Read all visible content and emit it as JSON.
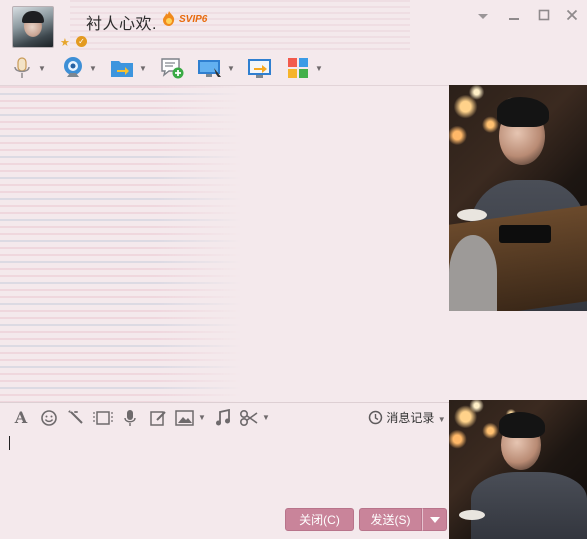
{
  "title_bar": {
    "nickname": "衬人心欢.",
    "vip_badge": "SVIP6",
    "icons": [
      "avatar",
      "flame-badge-icon",
      "star-icon",
      "verified-icon"
    ],
    "window_controls": [
      "dropdown-icon",
      "minimize-icon",
      "maximize-icon",
      "close-icon"
    ]
  },
  "toolbar": {
    "items": [
      "voice-call-icon",
      "video-call-icon",
      "send-file-icon",
      "new-discussion-icon",
      "remote-assist-icon",
      "share-screen-icon",
      "apps-grid-icon"
    ]
  },
  "input_toolbar": {
    "icons": [
      "font-icon",
      "emoji-icon",
      "magic-wand-icon",
      "screenshot-icon",
      "voice-message-icon",
      "edit-icon",
      "image-icon",
      "music-icon",
      "scissors-icon"
    ],
    "history_label": "消息记录"
  },
  "footer": {
    "close_label": "关闭(C)",
    "send_label": "发送(S)"
  },
  "colors": {
    "background": "#f4e9ec",
    "button": "#c9849a",
    "accent_orange": "#e86a0c"
  }
}
